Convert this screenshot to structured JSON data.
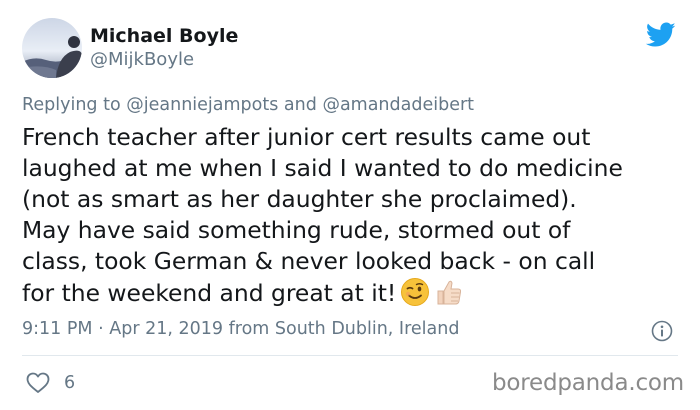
{
  "user": {
    "display_name": "Michael Boyle",
    "handle": "@MijkBoyle"
  },
  "reply": {
    "prefix": "Replying to",
    "mention_1": "@jeanniejampots",
    "conjunction": "and",
    "mention_2": "@amandadeibert"
  },
  "tweet": {
    "lines": [
      "French teacher after junior cert results came out",
      "laughed at me when I said I wanted to do medicine",
      "(not as smart as her daughter she proclaimed).",
      "May have said something rude, stormed out of",
      "class, took German & never looked back - on call",
      "for the weekend and great at it!"
    ],
    "emojis": [
      "winking-face-emoji",
      "thumbs-up-emoji"
    ]
  },
  "meta": {
    "time": "9:11 PM",
    "separator": "·",
    "date": "Apr 21, 2019",
    "source": "from South Dublin, Ireland"
  },
  "engagement": {
    "likes": "6"
  },
  "watermark": {
    "text": "boredpanda.com"
  },
  "colors": {
    "brand_blue": "#1da1f2",
    "text_primary": "#14171a",
    "text_secondary": "#657786",
    "divider": "#e1e8ed"
  },
  "icons": [
    "twitter-bird-icon",
    "info-icon",
    "heart-icon"
  ]
}
